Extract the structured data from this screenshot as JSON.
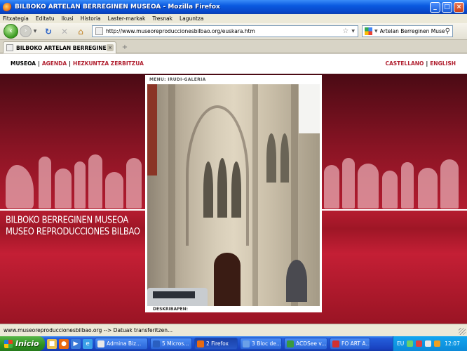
{
  "window": {
    "title": "BILBOKO ARTELAN BERREGINEN MUSEOA - Mozilla Firefox",
    "minimize": "_",
    "maximize": "□",
    "close": "×"
  },
  "menu": [
    "Fitxategia",
    "Editatu",
    "Ikusi",
    "Historia",
    "Laster-markak",
    "Tresnak",
    "Laguntza"
  ],
  "toolbar": {
    "url": "http://www.museoreproduccionesbilbao.org/euskara.htm",
    "search_engine_label": "Artelan Berreginen Museoa"
  },
  "tabs": [
    {
      "label": "BILBOKO ARTELAN BERREGINEN MUSE...",
      "close": "×"
    }
  ],
  "new_tab": "+",
  "page": {
    "nav_left": [
      "MUSEOA",
      "AGENDA",
      "HEZKUNTZA ZERBITZUA"
    ],
    "nav_right": [
      "CASTELLANO",
      "ENGLISH"
    ],
    "separator": "|",
    "gallery_label": "MENU: IRUDI-GALERIA",
    "description_label": "DESKRIBAPEN:",
    "title_line1": "BILBOKO BERREGINEN MUSEOA",
    "title_line2": "MUSEO REPRODUCCIONES BILBAO"
  },
  "status": "www.museoreproduccionesbilbao.org --> Datuak transferitzen...",
  "taskbar": {
    "start_label": "Inicio",
    "tasks": [
      {
        "label": "Admina Biz...",
        "color": "#e8e8e8"
      },
      {
        "label": "5 Micros...",
        "color": "#2a5fc0"
      },
      {
        "label": "2 Firefox",
        "color": "#e86a10"
      },
      {
        "label": "3 Bloc de...",
        "color": "#6aa0e8"
      },
      {
        "label": "ACDSee v...",
        "color": "#3a9a40"
      },
      {
        "label": "FO ART A...",
        "color": "#d03030"
      }
    ],
    "lang": "EU",
    "clock": "12:07"
  }
}
